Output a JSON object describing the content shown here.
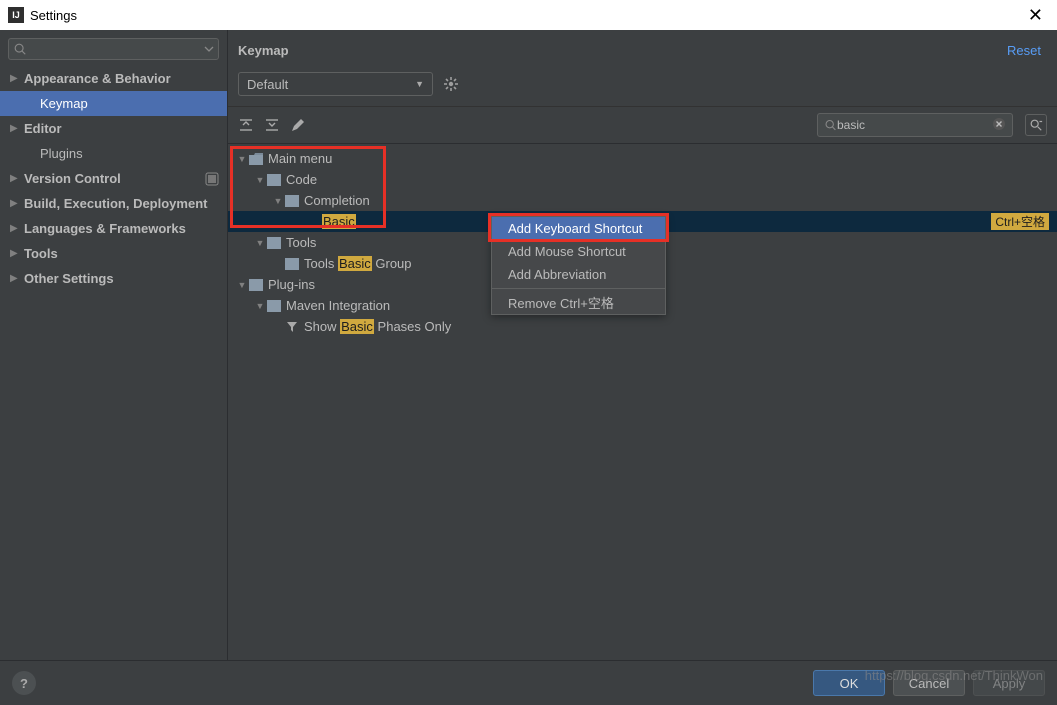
{
  "window": {
    "title": "Settings"
  },
  "sidebar": {
    "search_placeholder": "",
    "items": [
      {
        "label": "Appearance & Behavior",
        "hasChildren": true
      },
      {
        "label": "Keymap",
        "child": true,
        "selected": true
      },
      {
        "label": "Editor",
        "hasChildren": true
      },
      {
        "label": "Plugins",
        "child": true
      },
      {
        "label": "Version Control",
        "hasChildren": true,
        "project": true
      },
      {
        "label": "Build, Execution, Deployment",
        "hasChildren": true
      },
      {
        "label": "Languages & Frameworks",
        "hasChildren": true
      },
      {
        "label": "Tools",
        "hasChildren": true
      },
      {
        "label": "Other Settings",
        "hasChildren": true
      }
    ]
  },
  "panel": {
    "title": "Keymap",
    "reset": "Reset",
    "scheme": "Default",
    "search_value": "basic",
    "tree": {
      "main_menu": "Main menu",
      "code": "Code",
      "completion": "Completion",
      "basic": "Basic",
      "basic_shortcut": "Ctrl+空格",
      "tools": "Tools",
      "tools_group_pre": "Tools ",
      "tools_group_hl": "Basic",
      "tools_group_post": " Group",
      "plugins": "Plug-ins",
      "maven": "Maven Integration",
      "show_pre": "Show ",
      "show_hl": "Basic",
      "show_post": " Phases Only"
    },
    "contextmenu": {
      "add_kb": "Add Keyboard Shortcut",
      "add_mouse": "Add Mouse Shortcut",
      "add_abbr": "Add Abbreviation",
      "remove": "Remove Ctrl+空格"
    }
  },
  "footer": {
    "ok": "OK",
    "cancel": "Cancel",
    "apply": "Apply"
  },
  "watermark": "https://blog.csdn.net/ThinkWon"
}
